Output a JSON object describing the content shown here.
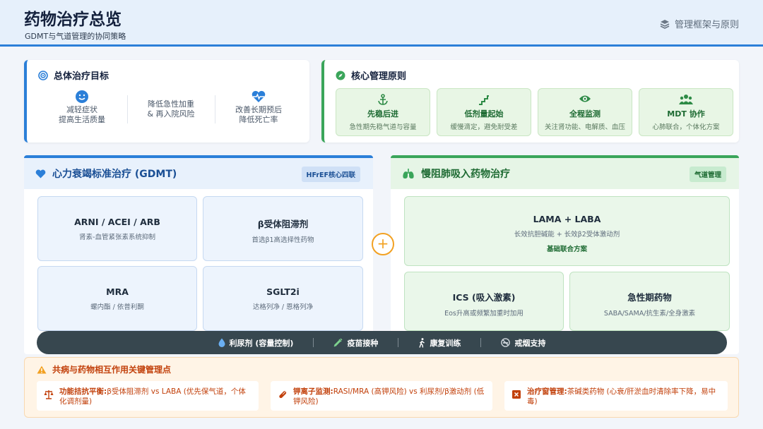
{
  "header": {
    "title": "药物治疗总览",
    "subtitle": "GDMT与气道管理的协同策略",
    "right_label": "管理框架与原则",
    "right_icon": "layers-icon"
  },
  "goals": {
    "title": "总体治疗目标",
    "items": [
      {
        "line1": "减轻症状",
        "line2": "提高生活质量",
        "icon": "smile-icon"
      },
      {
        "line1": "降低急性加重",
        "line2": "& 再入院风险",
        "icon": ""
      },
      {
        "line1": "改善长期预后",
        "line2": "降低死亡率",
        "icon": "heartbeat-icon"
      }
    ]
  },
  "principles": {
    "title": "核心管理原则",
    "items": [
      {
        "title": "先稳后进",
        "desc": "急性期先稳气道与容量",
        "icon": "anchor-icon"
      },
      {
        "title": "低剂量起始",
        "desc": "缓慢滴定，避免耐受差",
        "icon": "stairs-icon"
      },
      {
        "title": "全程监测",
        "desc": "关注肾功能、电解质、血压",
        "icon": "eye-icon"
      },
      {
        "title": "MDT 协作",
        "desc": "心肺联合，个体化方案",
        "icon": "team-icon"
      }
    ]
  },
  "gdmt": {
    "title": "心力衰竭标准治疗 (GDMT)",
    "badge": "HFrEF核心四联",
    "drugs": [
      {
        "name": "ARNI / ACEI / ARB",
        "desc": "肾素-血管紧张素系统抑制"
      },
      {
        "name": "β受体阻滞剂",
        "desc": "首选β1高选择性药物"
      },
      {
        "name": "MRA",
        "desc": "螺内酯 / 依普利酮"
      },
      {
        "name": "SGLT2i",
        "desc": "达格列净 / 恩格列净"
      }
    ]
  },
  "copd": {
    "title": "慢阻肺吸入药物治疗",
    "badge": "气道管理",
    "main": {
      "name": "LAMA + LABA",
      "desc": "长效抗胆碱能 + 长效β2受体激动剂",
      "note": "基础联合方案"
    },
    "drugs": [
      {
        "name": "ICS (吸入激素)",
        "desc": "Eos升高或频繁加重时加用"
      },
      {
        "name": "急性期药物",
        "desc": "SABA/SAMA/抗生素/全身激素"
      }
    ]
  },
  "connector": "+",
  "strip": {
    "items": [
      {
        "label": "利尿剂 (容量控制)",
        "icon": "droplet-icon"
      },
      {
        "label": "疫苗接种",
        "icon": "syringe-icon"
      },
      {
        "label": "康复训练",
        "icon": "walking-icon"
      },
      {
        "label": "戒烟支持",
        "icon": "no-smoking-icon"
      }
    ]
  },
  "interactions": {
    "title": "共病与药物相互作用关键管理点",
    "items": [
      {
        "key": "功能拮抗平衡:",
        "text": "β受体阻滞剂 vs LABA (优先保气道，个体化调剂量)",
        "icon": "balance-icon"
      },
      {
        "key": "钾离子监测:",
        "text": "RASI/MRA (高钾风险) vs 利尿剂/β激动剂 (低钾风险)",
        "icon": "pill-icon"
      },
      {
        "key": "治疗窗管理:",
        "text": "茶碱类药物 (心衰/肝淤血时清除率下降，易中毒)",
        "icon": "warning-box-icon"
      }
    ]
  },
  "colors": {
    "blue": "#2b7fd8",
    "green": "#3aa55a",
    "orange": "#f2a122",
    "alert": "#c2410c"
  }
}
